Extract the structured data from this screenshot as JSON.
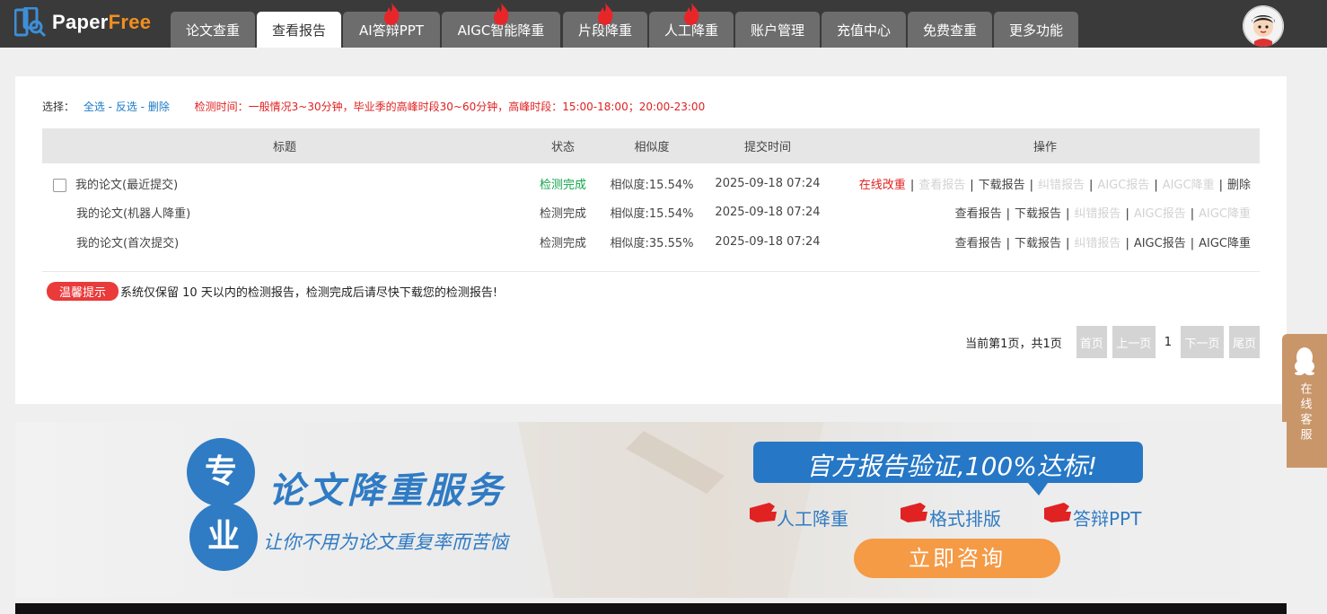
{
  "brand": {
    "name_left": "Paper",
    "name_right": "Free"
  },
  "tabs": [
    {
      "label": "论文查重",
      "hot": false,
      "active": false
    },
    {
      "label": "查看报告",
      "hot": false,
      "active": true
    },
    {
      "label": "AI答辩PPT",
      "hot": true,
      "active": false
    },
    {
      "label": "AIGC智能降重",
      "hot": true,
      "active": false
    },
    {
      "label": "片段降重",
      "hot": true,
      "active": false
    },
    {
      "label": "人工降重",
      "hot": true,
      "active": false
    },
    {
      "label": "账户管理",
      "hot": false,
      "active": false
    },
    {
      "label": "充值中心",
      "hot": false,
      "active": false
    },
    {
      "label": "免费查重",
      "hot": false,
      "active": false
    },
    {
      "label": "更多功能",
      "hot": false,
      "active": false
    }
  ],
  "toolbar": {
    "select_label": "选择：",
    "select_all": "全选",
    "sep": " - ",
    "invert": "反选",
    "delete": "删除",
    "notice": "检测时间：一般情况3~30分钟，毕业季的高峰时段30~60分钟，高峰时段：15:00-18:00；20:00-23:00"
  },
  "table": {
    "headers": {
      "title": "标题",
      "status": "状态",
      "similarity": "相似度",
      "submit_time": "提交时间",
      "actions": "操作"
    },
    "rows": [
      {
        "title": "我的论文(最近提交)",
        "status": "检测完成",
        "similarity": "相似度:15.54%",
        "time": "2025-09-18 07:24",
        "actions": [
          "在线改重",
          "查看报告",
          "下载报告",
          "纠错报告",
          "AIGC报告",
          "AIGC降重",
          "删除"
        ]
      },
      {
        "title": "我的论文(机器人降重)",
        "status": "检测完成",
        "similarity": "相似度:15.54%",
        "time": "2025-09-18 07:24",
        "actions": [
          "查看报告",
          "下载报告",
          "纠错报告",
          "AIGC报告",
          "AIGC降重"
        ]
      },
      {
        "title": "我的论文(首次提交)",
        "status": "检测完成",
        "similarity": "相似度:35.55%",
        "time": "2025-09-18 07:24",
        "actions": [
          "查看报告",
          "下载报告",
          "纠错报告",
          "AIGC报告",
          "AIGC降重"
        ]
      }
    ]
  },
  "tip": {
    "badge": "温馨提示",
    "text": "系统仅保留 10 天以内的检测报告，检测完成后请尽快下载您的检测报告!"
  },
  "pager": {
    "info": "当前第1页，共1页",
    "first": "首页",
    "prev": "上一页",
    "current": "1",
    "next": "下一页",
    "last": "尾页"
  },
  "side": {
    "text": "在线客服"
  },
  "banner": {
    "badge_top": "专",
    "badge_bottom": "业",
    "headline": "论文降重服务",
    "subline": "让你不用为论文重复率而苦恼",
    "slogan": "官方报告验证,100%达标!",
    "features": [
      "人工降重",
      "格式排版",
      "答辩PPT"
    ],
    "cta": "立即咨询"
  },
  "colors": {
    "nav_bg": "#3a3a3a",
    "tab_bg": "#6d6d6d",
    "brand_blue": "#1f6fb8",
    "accent_red": "#e02020",
    "success_green": "#12a64a",
    "cta_orange": "#f4913a",
    "side_brown": "#c9966a"
  }
}
